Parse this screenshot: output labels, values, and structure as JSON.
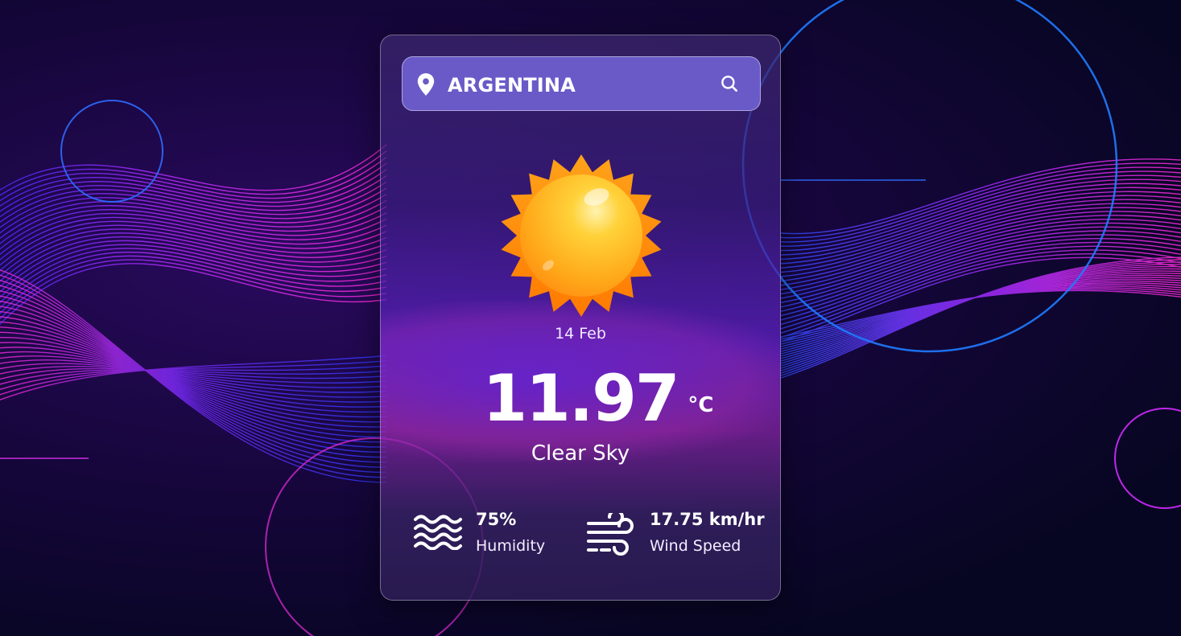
{
  "search": {
    "location": "ARGENTINA",
    "placeholder": ""
  },
  "weather": {
    "icon": "sun-icon",
    "date": "14 Feb",
    "temperature": "11.97",
    "unit": "°C",
    "description": "Clear Sky"
  },
  "stats": {
    "humidity": {
      "icon": "waves-icon",
      "value": "75%",
      "label": "Humidity"
    },
    "wind": {
      "icon": "wind-icon",
      "value": "17.75 km/hr",
      "label": "Wind Speed"
    }
  },
  "colors": {
    "search_bg": "#6a5ac8",
    "accent_pink": "#ff2bd6",
    "accent_blue": "#2d7bff",
    "sun_core": "#ffb21f",
    "sun_rays": "#ff8a00"
  }
}
